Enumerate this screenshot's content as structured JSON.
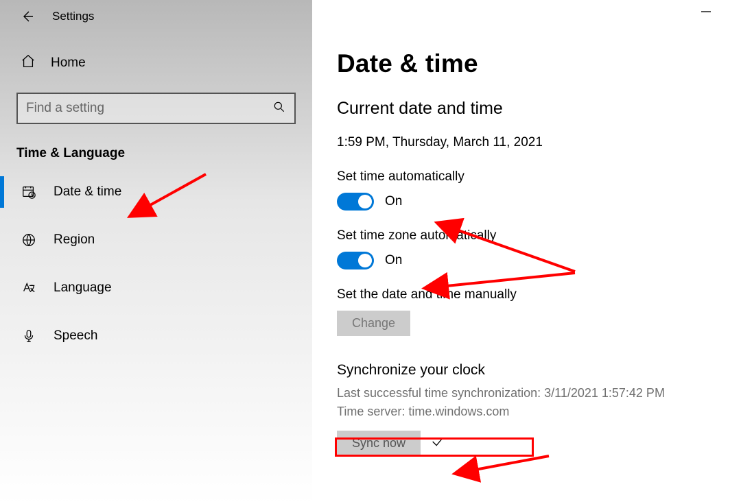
{
  "titlebar": {
    "app_title": "Settings"
  },
  "sidebar": {
    "home_label": "Home",
    "search_placeholder": "Find a setting",
    "category_title": "Time & Language",
    "items": [
      {
        "label": "Date & time",
        "selected": true
      },
      {
        "label": "Region",
        "selected": false
      },
      {
        "label": "Language",
        "selected": false
      },
      {
        "label": "Speech",
        "selected": false
      }
    ]
  },
  "main": {
    "page_title": "Date & time",
    "current_heading": "Current date and time",
    "current_value": "1:59 PM, Thursday, March 11, 2021",
    "set_time_auto": {
      "label": "Set time automatically",
      "state": "On"
    },
    "set_tz_auto": {
      "label": "Set time zone automatically",
      "state": "On"
    },
    "manual_label": "Set the date and time manually",
    "change_button": "Change",
    "sync_heading": "Synchronize your clock",
    "sync_last": "Last successful time synchronization: 3/11/2021 1:57:42 PM",
    "sync_server": "Time server: time.windows.com",
    "sync_button": "Sync now"
  }
}
